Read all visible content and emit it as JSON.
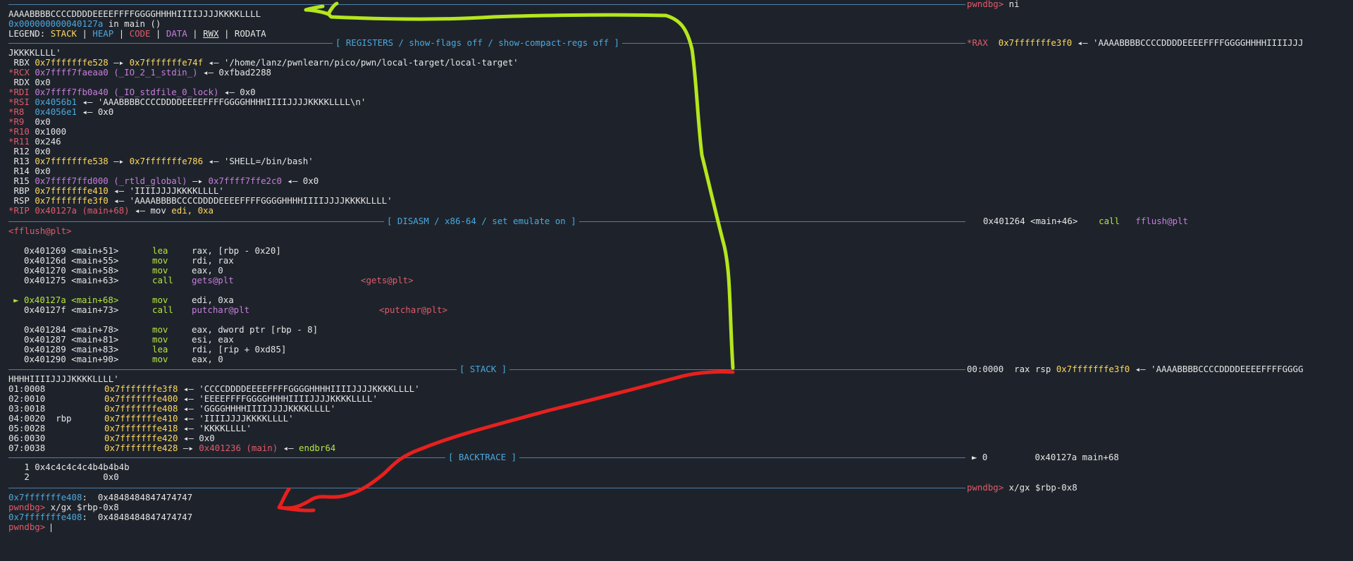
{
  "top": {
    "input_echo": "AAAABBBBCCCCDDDDEEEEFFFFGGGGHHHHIIIIJJJJKKKKLLLL",
    "location_addr": "0x000000000040127a",
    "location_rest": " in main ()",
    "legend_label": "LEGEND: ",
    "legend_stack": "STACK",
    "legend_heap": "HEAP",
    "legend_code": "CODE",
    "legend_data": "DATA",
    "legend_rwx": "RWX",
    "legend_rodata": "RODATA",
    "legend_sep": " | ",
    "prompt": "pwndbg>",
    "command": " ni"
  },
  "registers": {
    "header": "[ REGISTERS / show-flags off / show-compact-regs off ]",
    "rax_label": "*RAX",
    "rax_addr": "0x7fffffffe3f0",
    "rax_val": " ◂— 'AAAABBBBCCCCDDDDEEEEFFFFGGGGHHHHIIIIJJJ",
    "rax_wrap": "JKKKKLLLL'",
    "rows": [
      {
        "name": " RBX ",
        "a": "0x7fffffffe528",
        "b": " —▸ ",
        "c": "0x7fffffffe74f",
        "d": " ◂— '/home/lanz/pwnlearn/pico/pwn/local-target/local-target'",
        "nc": "white",
        "ac": "yellow",
        "cc": "yellow"
      },
      {
        "name": "*RCX ",
        "a": "0x7ffff7faeaa0 (_IO_2_1_stdin_)",
        "b": " ◂— 0xfbad2288",
        "c": "",
        "d": "",
        "nc": "red",
        "ac": "magenta",
        "cc": "white"
      },
      {
        "name": " RDX ",
        "a": "0x0",
        "b": "",
        "c": "",
        "d": "",
        "nc": "white",
        "ac": "white",
        "cc": "white"
      },
      {
        "name": "*RDI ",
        "a": "0x7ffff7fb0a40 (_IO_stdfile_0_lock)",
        "b": " ◂— 0x0",
        "c": "",
        "d": "",
        "nc": "red",
        "ac": "magenta",
        "cc": "white"
      },
      {
        "name": "*RSI ",
        "a": "0x4056b1",
        "b": " ◂— 'AAABBBBCCCCDDDDEEEEFFFFGGGGHHHHIIIIJJJJKKKKLLLL\\n'",
        "c": "",
        "d": "",
        "nc": "red",
        "ac": "cyan",
        "cc": "white"
      },
      {
        "name": "*R8  ",
        "a": "0x4056e1",
        "b": " ◂— 0x0",
        "c": "",
        "d": "",
        "nc": "red",
        "ac": "cyan",
        "cc": "white"
      },
      {
        "name": "*R9  ",
        "a": "0x0",
        "b": "",
        "c": "",
        "d": "",
        "nc": "red",
        "ac": "white",
        "cc": "white"
      },
      {
        "name": "*R10 ",
        "a": "0x1000",
        "b": "",
        "c": "",
        "d": "",
        "nc": "red",
        "ac": "white",
        "cc": "white"
      },
      {
        "name": "*R11 ",
        "a": "0x246",
        "b": "",
        "c": "",
        "d": "",
        "nc": "red",
        "ac": "white",
        "cc": "white"
      },
      {
        "name": " R12 ",
        "a": "0x0",
        "b": "",
        "c": "",
        "d": "",
        "nc": "white",
        "ac": "white",
        "cc": "white"
      },
      {
        "name": " R13 ",
        "a": "0x7fffffffe538",
        "b": " —▸ ",
        "c": "0x7fffffffe786",
        "d": " ◂— 'SHELL=/bin/bash'",
        "nc": "white",
        "ac": "yellow",
        "cc": "yellow"
      },
      {
        "name": " R14 ",
        "a": "0x0",
        "b": "",
        "c": "",
        "d": "",
        "nc": "white",
        "ac": "white",
        "cc": "white"
      },
      {
        "name": " R15 ",
        "a": "0x7ffff7ffd000 (_rtld_global)",
        "b": " —▸ ",
        "c": "0x7ffff7ffe2c0",
        "d": " ◂— 0x0",
        "nc": "white",
        "ac": "magenta",
        "cc": "magenta"
      },
      {
        "name": " RBP ",
        "a": "0x7fffffffe410",
        "b": " ◂— 'IIIIJJJJKKKKLLLL'",
        "c": "",
        "d": "",
        "nc": "white",
        "ac": "yellow",
        "cc": "white"
      },
      {
        "name": " RSP ",
        "a": "0x7fffffffe3f0",
        "b": " ◂— 'AAAABBBBCCCCDDDDEEEEFFFFGGGGHHHHIIIIJJJJKKKKLLLL'",
        "c": "",
        "d": "",
        "nc": "white",
        "ac": "yellow",
        "cc": "white"
      },
      {
        "name": "*RIP ",
        "a": "0x40127a (main+68)",
        "b": " ◂— mov ",
        "c": "edi, 0xa",
        "d": "",
        "nc": "red",
        "ac": "red",
        "cc": "yellow"
      }
    ]
  },
  "disasm": {
    "header": "[ DISASM / x86-64 / set emulate on ]",
    "first_addr": "0x401264 <main+46>",
    "first_mn": "call",
    "first_op": "fflush@plt",
    "first_wrap": "<fflush@plt>",
    "rows": [
      {
        "marker": "",
        "addr": "0x401269 <main+51>",
        "mn": "lea",
        "op": "rax, [rbp - 0x20]",
        "tgt": "",
        "gap": false
      },
      {
        "marker": "",
        "addr": "0x40126d <main+55>",
        "mn": "mov",
        "op": "rdi, rax",
        "tgt": "",
        "gap": false
      },
      {
        "marker": "",
        "addr": "0x401270 <main+58>",
        "mn": "mov",
        "op": "eax, 0",
        "tgt": "",
        "gap": false
      },
      {
        "marker": "",
        "addr": "0x401275 <main+63>",
        "mn": "call",
        "op": "gets@plt",
        "tgt": "<gets@plt>",
        "gap": false
      },
      {
        "marker": "►",
        "addr": "0x40127a <main+68>",
        "mn": "mov",
        "op": "edi, 0xa",
        "tgt": "",
        "gap": true
      },
      {
        "marker": "",
        "addr": "0x40127f <main+73>",
        "mn": "call",
        "op": "putchar@plt",
        "tgt": "<putchar@plt>",
        "gap": false
      },
      {
        "marker": "",
        "addr": "0x401284 <main+78>",
        "mn": "mov",
        "op": "eax, dword ptr [rbp - 8]",
        "tgt": "",
        "gap": true
      },
      {
        "marker": "",
        "addr": "0x401287 <main+81>",
        "mn": "mov",
        "op": "esi, eax",
        "tgt": "",
        "gap": false
      },
      {
        "marker": "",
        "addr": "0x401289 <main+83>",
        "mn": "lea",
        "op": "rdi, [rip + 0xd85]",
        "tgt": "",
        "gap": false
      },
      {
        "marker": "",
        "addr": "0x401290 <main+90>",
        "mn": "mov",
        "op": "eax, 0",
        "tgt": "",
        "gap": false
      }
    ]
  },
  "stack": {
    "header": "[ STACK ]",
    "first_idx": "00:0000  rax rsp ",
    "first_addr": "0x7fffffffe3f0",
    "first_val": " ◂— 'AAAABBBBCCCCDDDDEEEEFFFFGGGG",
    "first_wrap": "HHHHIIIIJJJJKKKKLLLL'",
    "rows": [
      {
        "idx": "01:0008      ",
        "addr": "0x7fffffffe3f8",
        "val": " ◂— 'CCCCDDDDEEEEFFFFGGGGHHHHIIIIJJJJKKKKLLLL'",
        "val2": "",
        "vc": "white"
      },
      {
        "idx": "02:0010      ",
        "addr": "0x7fffffffe400",
        "val": " ◂— 'EEEEFFFFGGGGHHHHIIIIJJJJKKKKLLLL'",
        "val2": "",
        "vc": "white"
      },
      {
        "idx": "03:0018      ",
        "addr": "0x7fffffffe408",
        "val": " ◂— 'GGGGHHHHIIIIJJJJKKKKLLLL'",
        "val2": "",
        "vc": "white"
      },
      {
        "idx": "04:0020  rbp ",
        "addr": "0x7fffffffe410",
        "val": " ◂— 'IIIIJJJJKKKKLLLL'",
        "val2": "",
        "vc": "white"
      },
      {
        "idx": "05:0028      ",
        "addr": "0x7fffffffe418",
        "val": " ◂— 'KKKKLLLL'",
        "val2": "",
        "vc": "white"
      },
      {
        "idx": "06:0030      ",
        "addr": "0x7fffffffe420",
        "val": " ◂— 0x0",
        "val2": "",
        "vc": "white"
      },
      {
        "idx": "07:0038      ",
        "addr": "0x7fffffffe428",
        "val": " —▸ ",
        "val2": "0x401236 (main)",
        "tail": " ◂— endbr64",
        "vc": "red"
      }
    ]
  },
  "backtrace": {
    "header": "[ BACKTRACE ]",
    "first": "► 0         0x40127a main+68",
    "row1": "   1 0x4c4c4c4c4b4b4b4b",
    "row2": "   2              0x0"
  },
  "console": {
    "prompt": "pwndbg>",
    "cmd": " x/gx $rbp-0x8",
    "out1_addr": "0x7fffffffe408",
    "out1_val": ":  0x4848484847474747",
    "line2_prompt": "pwndbg>",
    "line2_cmd": " x/gx $rbp-0x8",
    "out2_addr": "0x7fffffffe408",
    "out2_val": ":  0x4848484847474747",
    "final_prompt": "pwndbg>"
  },
  "annotations": {
    "green": "#b5e61d",
    "red": "#e8201e"
  }
}
